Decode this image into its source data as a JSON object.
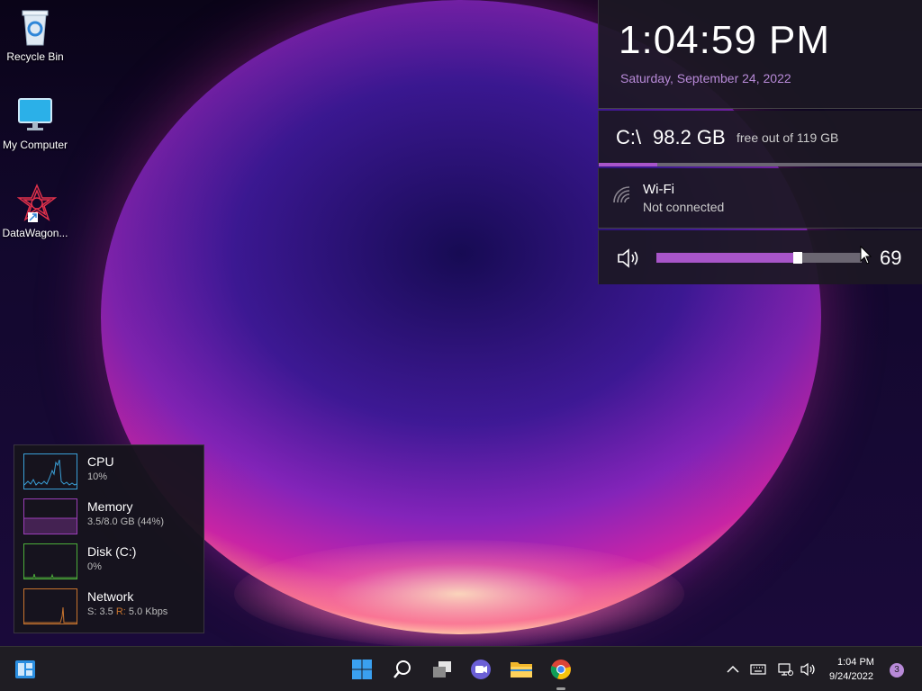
{
  "desktop": {
    "icons": [
      {
        "label": "Recycle Bin"
      },
      {
        "label": "My Computer"
      },
      {
        "label": "DataWagon..."
      }
    ]
  },
  "panel": {
    "clock": {
      "time": "1:04:59 PM",
      "date": "Saturday, September 24, 2022"
    },
    "disk": {
      "drive": "C:\\",
      "free": "98.2 GB",
      "subtitle": "free out of 119 GB",
      "used_fraction": 0.18
    },
    "wifi": {
      "title": "Wi-Fi",
      "status": "Not connected"
    },
    "volume": {
      "value": "69",
      "level_fraction": 0.69
    }
  },
  "resources": {
    "cpu": {
      "name": "CPU",
      "value": "10%",
      "color": "#3aa0d8"
    },
    "memory": {
      "name": "Memory",
      "value": "3.5/8.0 GB (44%)",
      "color": "#9b3fb8"
    },
    "disk": {
      "name": "Disk (C:)",
      "value": "0%",
      "color": "#4cae3a"
    },
    "network": {
      "name": "Network",
      "value_s_label": "S:",
      "value_s": "3.5",
      "value_r_label": "R:",
      "value_r": "5.0 Kbps",
      "color": "#c8742e"
    }
  },
  "taskbar": {
    "clock_time": "1:04 PM",
    "clock_date": "9/24/2022",
    "notifications": "3",
    "apps": [
      "widgets",
      "start",
      "search",
      "task-view",
      "teams-chat",
      "file-explorer",
      "chrome"
    ]
  },
  "colors": {
    "accent": "#a855c9",
    "date_text": "#b88ad8"
  }
}
